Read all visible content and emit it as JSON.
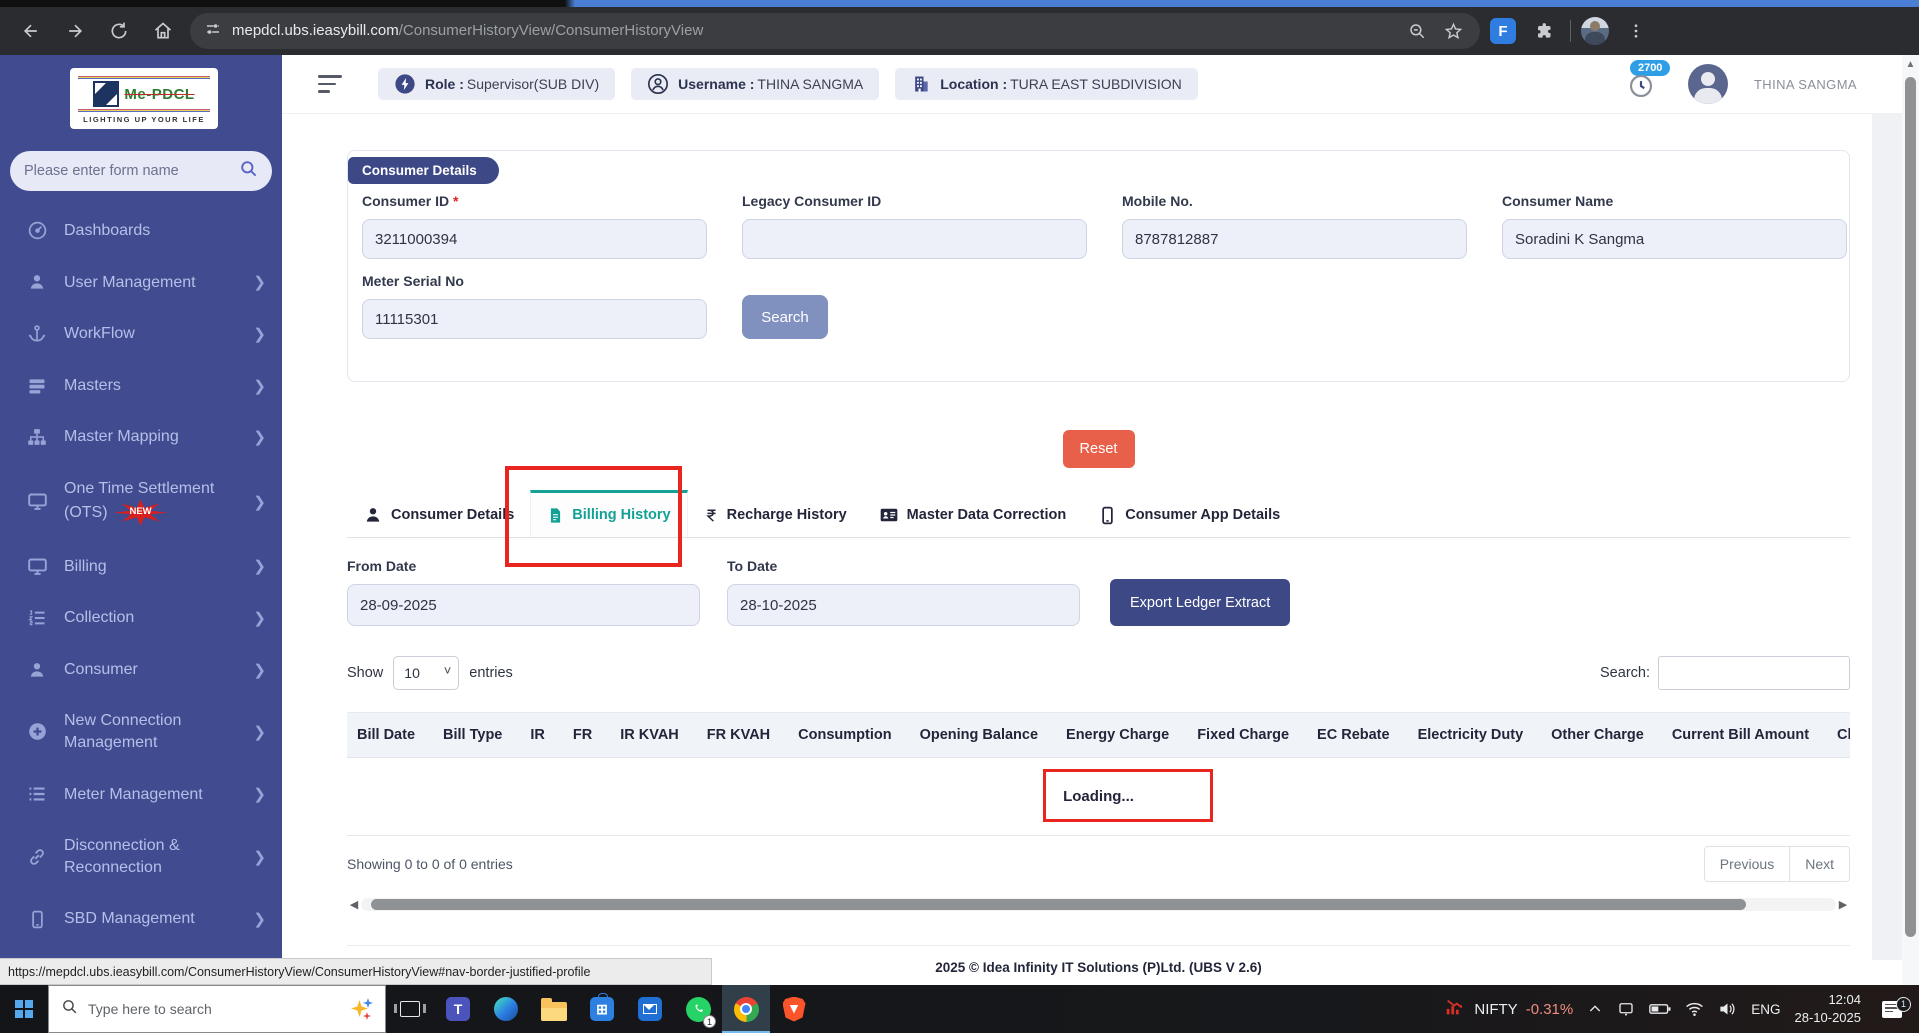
{
  "browser": {
    "url_domain": "mepdcl.ubs.ieasybill.com",
    "url_path": "/ConsumerHistoryView/ConsumerHistoryView",
    "status_link": "https://mepdcl.ubs.ieasybill.com/ConsumerHistoryView/ConsumerHistoryView#nav-border-justified-profile"
  },
  "header": {
    "role_label": "Role :",
    "role_value": "Supervisor(SUB DIV)",
    "username_label": "Username :",
    "username_value": "THINA SANGMA",
    "location_label": "Location :",
    "location_value": "TURA EAST SUBDIVISION",
    "notification_count": "2700",
    "profile_name": "THINA SANGMA"
  },
  "sidebar": {
    "logo_title": "Me-PDCL",
    "logo_subtitle": "LIGHTING UP YOUR LIFE",
    "search_placeholder": "Please enter form name",
    "items": [
      {
        "label": "Dashboards",
        "icon": "gauge",
        "arrow": false
      },
      {
        "label": "User Management",
        "icon": "user",
        "arrow": true
      },
      {
        "label": "WorkFlow",
        "icon": "anchor",
        "arrow": true
      },
      {
        "label": "Masters",
        "icon": "bars",
        "arrow": true
      },
      {
        "label": "Master Mapping",
        "icon": "sitemap",
        "arrow": true
      },
      {
        "label": "One Time Settlement (OTS)",
        "icon": "monitor",
        "arrow": true,
        "badge": "NEW"
      },
      {
        "label": "Billing",
        "icon": "monitor",
        "arrow": true
      },
      {
        "label": "Collection",
        "icon": "listol",
        "arrow": true
      },
      {
        "label": "Consumer",
        "icon": "user",
        "arrow": true
      },
      {
        "label": "New Connection Management",
        "icon": "pluscircle",
        "arrow": true
      },
      {
        "label": "Meter Management",
        "icon": "list",
        "arrow": true
      },
      {
        "label": "Disconnection & Reconnection",
        "icon": "link",
        "arrow": true
      },
      {
        "label": "SBD Management",
        "icon": "mobile",
        "arrow": true
      }
    ]
  },
  "consumer_form": {
    "card_title": "Consumer Details",
    "consumer_id_label": "Consumer ID",
    "consumer_id_required": "*",
    "consumer_id_value": "3211000394",
    "legacy_id_label": "Legacy Consumer ID",
    "legacy_id_value": "",
    "mobile_label": "Mobile No.",
    "mobile_value": "8787812887",
    "name_label": "Consumer Name",
    "name_value": "Soradini K Sangma",
    "meter_label": "Meter Serial No",
    "meter_value": "11115301",
    "search_button": "Search",
    "reset_button": "Reset"
  },
  "tabs": [
    {
      "label": "Consumer Details",
      "icon": "user",
      "active": false
    },
    {
      "label": "Billing History",
      "icon": "file",
      "active": true
    },
    {
      "label": "Recharge History",
      "icon": "rupee",
      "active": false
    },
    {
      "label": "Master Data Correction",
      "icon": "idcard",
      "active": false
    },
    {
      "label": "Consumer App Details",
      "icon": "mobile",
      "active": false
    }
  ],
  "billing_history": {
    "from_date_label": "From Date",
    "from_date_value": "28-09-2025",
    "to_date_label": "To Date",
    "to_date_value": "28-10-2025",
    "export_button": "Export Ledger Extract",
    "show_label": "Show",
    "page_size": "10",
    "entries_label": "entries",
    "search_label": "Search:",
    "table_headers": [
      "Bill Date",
      "Bill Type",
      "IR",
      "FR",
      "IR KVAH",
      "FR KVAH",
      "Consumption",
      "Opening Balance",
      "Energy Charge",
      "Fixed Charge",
      "EC Rebate",
      "Electricity Duty",
      "Other Charge",
      "Current Bill Amount",
      "Closing"
    ],
    "loading_text": "Loading...",
    "showing_text": "Showing 0 to 0 of 0 entries",
    "previous_button": "Previous",
    "next_button": "Next"
  },
  "footer": {
    "copyright": "2025 © Idea Infinity IT Solutions (P)Ltd. (UBS V 2.6)"
  },
  "taskbar": {
    "search_placeholder": "Type here to search",
    "stock_ticker": "NIFTY",
    "stock_change": "-0.31%",
    "language": "ENG",
    "time": "12:04",
    "date": "28-10-2025",
    "whatsapp_badge": "1",
    "notification_badge": "1"
  },
  "colors": {
    "sidebar": "#414c90",
    "navy": "#3d4886",
    "teal_active_tab": "#14a195",
    "reset_coral": "#e9604a",
    "gear_blue": "#2aa9e1",
    "badge_blue": "#2e9fe6",
    "annotation_red": "#e8261f"
  }
}
